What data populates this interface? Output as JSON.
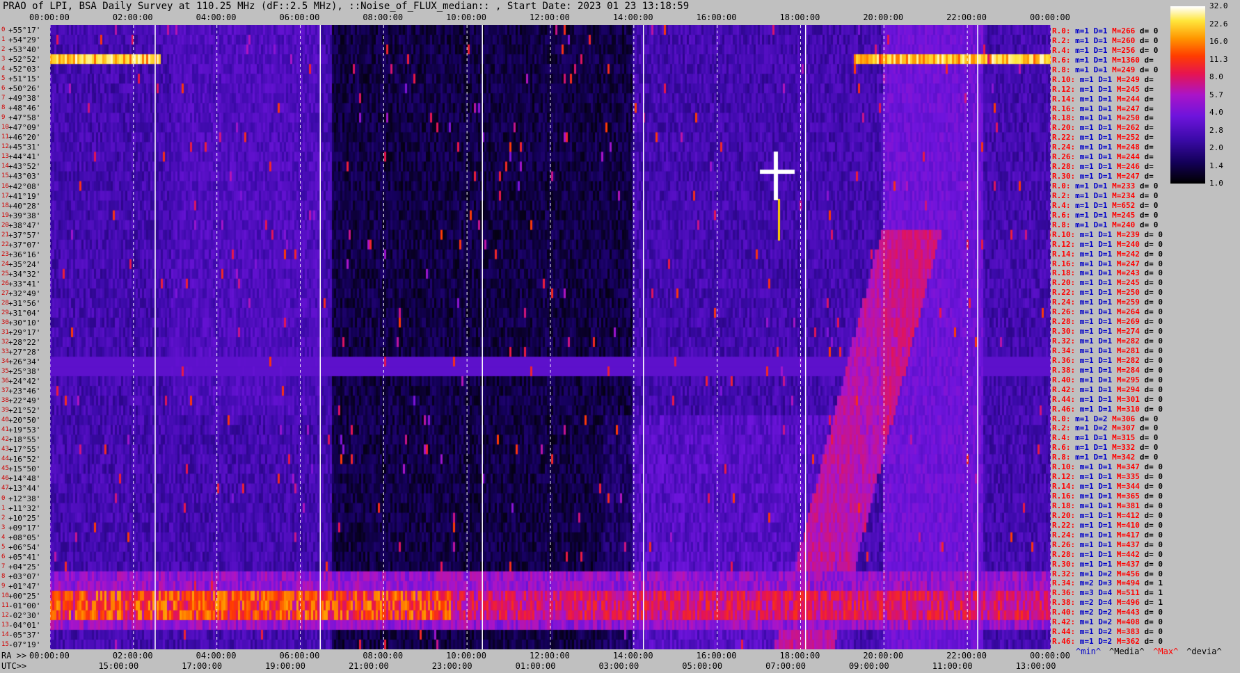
{
  "title": "PRAO of LPI, BSA Daily Survey at 110.25 MHz (dF::2.5 MHz), ::Noise_of_FLUX_median:: , Start Date: 2023 01 23 13:18:59",
  "chart_data": {
    "type": "heatmap",
    "title": "PRAO of LPI, BSA Daily Survey at 110.25 MHz (dF::2.5 MHz), ::Noise_of_FLUX_median:: , Start Date: 2023 01 23 13:18:59",
    "x_top_ticks": [
      "00:00:00",
      "02:00:00",
      "04:00:00",
      "06:00:00",
      "08:00:00",
      "10:00:00",
      "12:00:00",
      "14:00:00",
      "16:00:00",
      "18:00:00",
      "20:00:00",
      "22:00:00",
      "00:00:00"
    ],
    "x_bottom_ra_prefix": "RA >>",
    "x_bottom_ra_ticks": [
      "00:00:00",
      "02:00:00",
      "04:00:00",
      "06:00:00",
      "08:00:00",
      "10:00:00",
      "12:00:00",
      "14:00:00",
      "16:00:00",
      "18:00:00",
      "20:00:00",
      "22:00:00",
      "00:00:00"
    ],
    "x_bottom_utc_prefix": "UTC>>",
    "x_bottom_utc_ticks": [
      "15:00:00",
      "17:00:00",
      "19:00:00",
      "21:00:00",
      "23:00:00",
      "01:00:00",
      "03:00:00",
      "05:00:00",
      "07:00:00",
      "09:00:00",
      "11:00:00",
      "13:00:00"
    ],
    "y_labels": [
      "+55°17'",
      "+54°29'",
      "+53°40'",
      "+52°52'",
      "+52°03'",
      "+51°15'",
      "+50°26'",
      "+49°38'",
      "+48°46'",
      "+47°58'",
      "+47°09'",
      "+46°20'",
      "+45°31'",
      "+44°41'",
      "+43°52'",
      "+43°03'",
      "+42°08'",
      "+41°19'",
      "+40°28'",
      "+39°38'",
      "+38°47'",
      "+37°57'",
      "+37°07'",
      "+36°16'",
      "+35°24'",
      "+34°32'",
      "+33°41'",
      "+32°49'",
      "+31°56'",
      "+31°04'",
      "+30°10'",
      "+29°17'",
      "+28°22'",
      "+27°28'",
      "+26°34'",
      "+25°38'",
      "+24°42'",
      "+23°46'",
      "+22°49'",
      "+21°52'",
      "+20°50'",
      "+19°53'",
      "+18°55'",
      "+17°55'",
      "+16°52'",
      "+15°50'",
      "+14°48'",
      "+13°44'",
      "+12°38'",
      "+11°32'",
      "+10°25'",
      "+09°17'",
      "+08°05'",
      "+06°54'",
      "+05°41'",
      "+04°25'",
      "+03°07'",
      "+01°47'",
      "+00°25'",
      "-01°00'",
      "-02°30'",
      "-04°01'",
      "-05°37'",
      "-07°19'"
    ],
    "row_index_labels": [
      "0",
      "1",
      "2",
      "3",
      "4",
      "5",
      "6",
      "7",
      "8",
      "9",
      "10",
      "11",
      "12",
      "13",
      "14",
      "15",
      "16",
      "17",
      "18",
      "19",
      "20",
      "21",
      "22",
      "23",
      "24",
      "25",
      "26",
      "27",
      "28",
      "29",
      "30",
      "31",
      "32",
      "33",
      "34",
      "35",
      "36",
      "37",
      "38",
      "39",
      "40",
      "41",
      "42",
      "43",
      "44",
      "45",
      "46",
      "47",
      "0",
      "1",
      "2",
      "3",
      "4",
      "5",
      "6",
      "7",
      "8",
      "9",
      "10",
      "11",
      "12",
      "13",
      "14",
      "15"
    ],
    "colorbar": {
      "ticks": [
        "32.0",
        "22.6",
        "16.0",
        "11.3",
        "8.0",
        "5.7",
        "4.0",
        "2.8",
        "2.0",
        "1.4",
        "1.0"
      ],
      "min": 1.0,
      "max": 32.0,
      "scale": "log2"
    },
    "right_stats": [
      {
        "r": "R.0:",
        "m": "m=1",
        "d": "D=1",
        "mm": "M=266",
        "dd": "d= 0"
      },
      {
        "r": "R.2:",
        "m": "m=1",
        "d": "D=1",
        "mm": "M=260",
        "dd": "d= 0"
      },
      {
        "r": "R.4:",
        "m": "m=1",
        "d": "D=1",
        "mm": "M=256",
        "dd": "d= 0"
      },
      {
        "r": "R.6:",
        "m": "m=1",
        "d": "D=1",
        "mm": "M=1360",
        "dd": "d="
      },
      {
        "r": "R.8:",
        "m": "m=1",
        "d": "D=1",
        "mm": "M=249",
        "dd": "d= 0"
      },
      {
        "r": "R.10:",
        "m": "m=1",
        "d": "D=1",
        "mm": "M=249",
        "dd": "d="
      },
      {
        "r": "R.12:",
        "m": "m=1",
        "d": "D=1",
        "mm": "M=245",
        "dd": "d="
      },
      {
        "r": "R.14:",
        "m": "m=1",
        "d": "D=1",
        "mm": "M=244",
        "dd": "d="
      },
      {
        "r": "R.16:",
        "m": "m=1",
        "d": "D=1",
        "mm": "M=247",
        "dd": "d="
      },
      {
        "r": "R.18:",
        "m": "m=1",
        "d": "D=1",
        "mm": "M=250",
        "dd": "d="
      },
      {
        "r": "R.20:",
        "m": "m=1",
        "d": "D=1",
        "mm": "M=262",
        "dd": "d="
      },
      {
        "r": "R.22:",
        "m": "m=1",
        "d": "D=1",
        "mm": "M=252",
        "dd": "d="
      },
      {
        "r": "R.24:",
        "m": "m=1",
        "d": "D=1",
        "mm": "M=248",
        "dd": "d="
      },
      {
        "r": "R.26:",
        "m": "m=1",
        "d": "D=1",
        "mm": "M=244",
        "dd": "d="
      },
      {
        "r": "R.28:",
        "m": "m=1",
        "d": "D=1",
        "mm": "M=246",
        "dd": "d="
      },
      {
        "r": "R.30:",
        "m": "m=1",
        "d": "D=1",
        "mm": "M=247",
        "dd": "d="
      },
      {
        "r": "R.0:",
        "m": "m=1",
        "d": "D=1",
        "mm": "M=233",
        "dd": "d= 0"
      },
      {
        "r": "R.2:",
        "m": "m=1",
        "d": "D=1",
        "mm": "M=234",
        "dd": "d= 0"
      },
      {
        "r": "R.4:",
        "m": "m=1",
        "d": "D=1",
        "mm": "M=652",
        "dd": "d= 0"
      },
      {
        "r": "R.6:",
        "m": "m=1",
        "d": "D=1",
        "mm": "M=245",
        "dd": "d= 0"
      },
      {
        "r": "R.8:",
        "m": "m=1",
        "d": "D=1",
        "mm": "M=240",
        "dd": "d= 0"
      },
      {
        "r": "R.10:",
        "m": "m=1",
        "d": "D=1",
        "mm": "M=239",
        "dd": "d= 0"
      },
      {
        "r": "R.12:",
        "m": "m=1",
        "d": "D=1",
        "mm": "M=240",
        "dd": "d= 0"
      },
      {
        "r": "R.14:",
        "m": "m=1",
        "d": "D=1",
        "mm": "M=242",
        "dd": "d= 0"
      },
      {
        "r": "R.16:",
        "m": "m=1",
        "d": "D=1",
        "mm": "M=247",
        "dd": "d= 0"
      },
      {
        "r": "R.18:",
        "m": "m=1",
        "d": "D=1",
        "mm": "M=243",
        "dd": "d= 0"
      },
      {
        "r": "R.20:",
        "m": "m=1",
        "d": "D=1",
        "mm": "M=245",
        "dd": "d= 0"
      },
      {
        "r": "R.22:",
        "m": "m=1",
        "d": "D=1",
        "mm": "M=250",
        "dd": "d= 0"
      },
      {
        "r": "R.24:",
        "m": "m=1",
        "d": "D=1",
        "mm": "M=259",
        "dd": "d= 0"
      },
      {
        "r": "R.26:",
        "m": "m=1",
        "d": "D=1",
        "mm": "M=264",
        "dd": "d= 0"
      },
      {
        "r": "R.28:",
        "m": "m=1",
        "d": "D=1",
        "mm": "M=269",
        "dd": "d= 0"
      },
      {
        "r": "R.30:",
        "m": "m=1",
        "d": "D=1",
        "mm": "M=274",
        "dd": "d= 0"
      },
      {
        "r": "R.32:",
        "m": "m=1",
        "d": "D=1",
        "mm": "M=282",
        "dd": "d= 0"
      },
      {
        "r": "R.34:",
        "m": "m=1",
        "d": "D=1",
        "mm": "M=281",
        "dd": "d= 0"
      },
      {
        "r": "R.36:",
        "m": "m=1",
        "d": "D=1",
        "mm": "M=282",
        "dd": "d= 0"
      },
      {
        "r": "R.38:",
        "m": "m=1",
        "d": "D=1",
        "mm": "M=284",
        "dd": "d= 0"
      },
      {
        "r": "R.40:",
        "m": "m=1",
        "d": "D=1",
        "mm": "M=295",
        "dd": "d= 0"
      },
      {
        "r": "R.42:",
        "m": "m=1",
        "d": "D=1",
        "mm": "M=294",
        "dd": "d= 0"
      },
      {
        "r": "R.44:",
        "m": "m=1",
        "d": "D=1",
        "mm": "M=301",
        "dd": "d= 0"
      },
      {
        "r": "R.46:",
        "m": "m=1",
        "d": "D=1",
        "mm": "M=310",
        "dd": "d= 0"
      },
      {
        "r": "R.0:",
        "m": "m=1",
        "d": "D=2",
        "mm": "M=306",
        "dd": "d= 0"
      },
      {
        "r": "R.2:",
        "m": "m=1",
        "d": "D=2",
        "mm": "M=307",
        "dd": "d= 0"
      },
      {
        "r": "R.4:",
        "m": "m=1",
        "d": "D=1",
        "mm": "M=315",
        "dd": "d= 0"
      },
      {
        "r": "R.6:",
        "m": "m=1",
        "d": "D=1",
        "mm": "M=332",
        "dd": "d= 0"
      },
      {
        "r": "R.8:",
        "m": "m=1",
        "d": "D=1",
        "mm": "M=342",
        "dd": "d= 0"
      },
      {
        "r": "R.10:",
        "m": "m=1",
        "d": "D=1",
        "mm": "M=347",
        "dd": "d= 0"
      },
      {
        "r": "R.12:",
        "m": "m=1",
        "d": "D=1",
        "mm": "M=335",
        "dd": "d= 0"
      },
      {
        "r": "R.14:",
        "m": "m=1",
        "d": "D=1",
        "mm": "M=344",
        "dd": "d= 0"
      },
      {
        "r": "R.16:",
        "m": "m=1",
        "d": "D=1",
        "mm": "M=365",
        "dd": "d= 0"
      },
      {
        "r": "R.18:",
        "m": "m=1",
        "d": "D=1",
        "mm": "M=381",
        "dd": "d= 0"
      },
      {
        "r": "R.20:",
        "m": "m=1",
        "d": "D=1",
        "mm": "M=412",
        "dd": "d= 0"
      },
      {
        "r": "R.22:",
        "m": "m=1",
        "d": "D=1",
        "mm": "M=410",
        "dd": "d= 0"
      },
      {
        "r": "R.24:",
        "m": "m=1",
        "d": "D=1",
        "mm": "M=417",
        "dd": "d= 0"
      },
      {
        "r": "R.26:",
        "m": "m=1",
        "d": "D=1",
        "mm": "M=437",
        "dd": "d= 0"
      },
      {
        "r": "R.28:",
        "m": "m=1",
        "d": "D=1",
        "mm": "M=442",
        "dd": "d= 0"
      },
      {
        "r": "R.30:",
        "m": "m=1",
        "d": "D=1",
        "mm": "M=437",
        "dd": "d= 0"
      },
      {
        "r": "R.32:",
        "m": "m=1",
        "d": "D=2",
        "mm": "M=456",
        "dd": "d= 0"
      },
      {
        "r": "R.34:",
        "m": "m=2",
        "d": "D=3",
        "mm": "M=494",
        "dd": "d= 1"
      },
      {
        "r": "R.36:",
        "m": "m=3",
        "d": "D=4",
        "mm": "M=511",
        "dd": "d= 1"
      },
      {
        "r": "R.38:",
        "m": "m=2",
        "d": "D=4",
        "mm": "M=496",
        "dd": "d= 1"
      },
      {
        "r": "R.40:",
        "m": "m=2",
        "d": "D=2",
        "mm": "M=443",
        "dd": "d= 0"
      },
      {
        "r": "R.42:",
        "m": "m=1",
        "d": "D=2",
        "mm": "M=408",
        "dd": "d= 0"
      },
      {
        "r": "R.44:",
        "m": "m=1",
        "d": "D=2",
        "mm": "M=383",
        "dd": "d= 0"
      },
      {
        "r": "R.46:",
        "m": "m=1",
        "d": "D=2",
        "mm": "M=362",
        "dd": "d= 0"
      }
    ],
    "legend_bottom": [
      {
        "text": "^min^",
        "color": "#0000c8"
      },
      {
        "text": "^Media^",
        "color": "#000000"
      },
      {
        "text": "^Max^",
        "color": "#ff0000"
      },
      {
        "text": "^devia^",
        "color": "#000000"
      }
    ]
  }
}
